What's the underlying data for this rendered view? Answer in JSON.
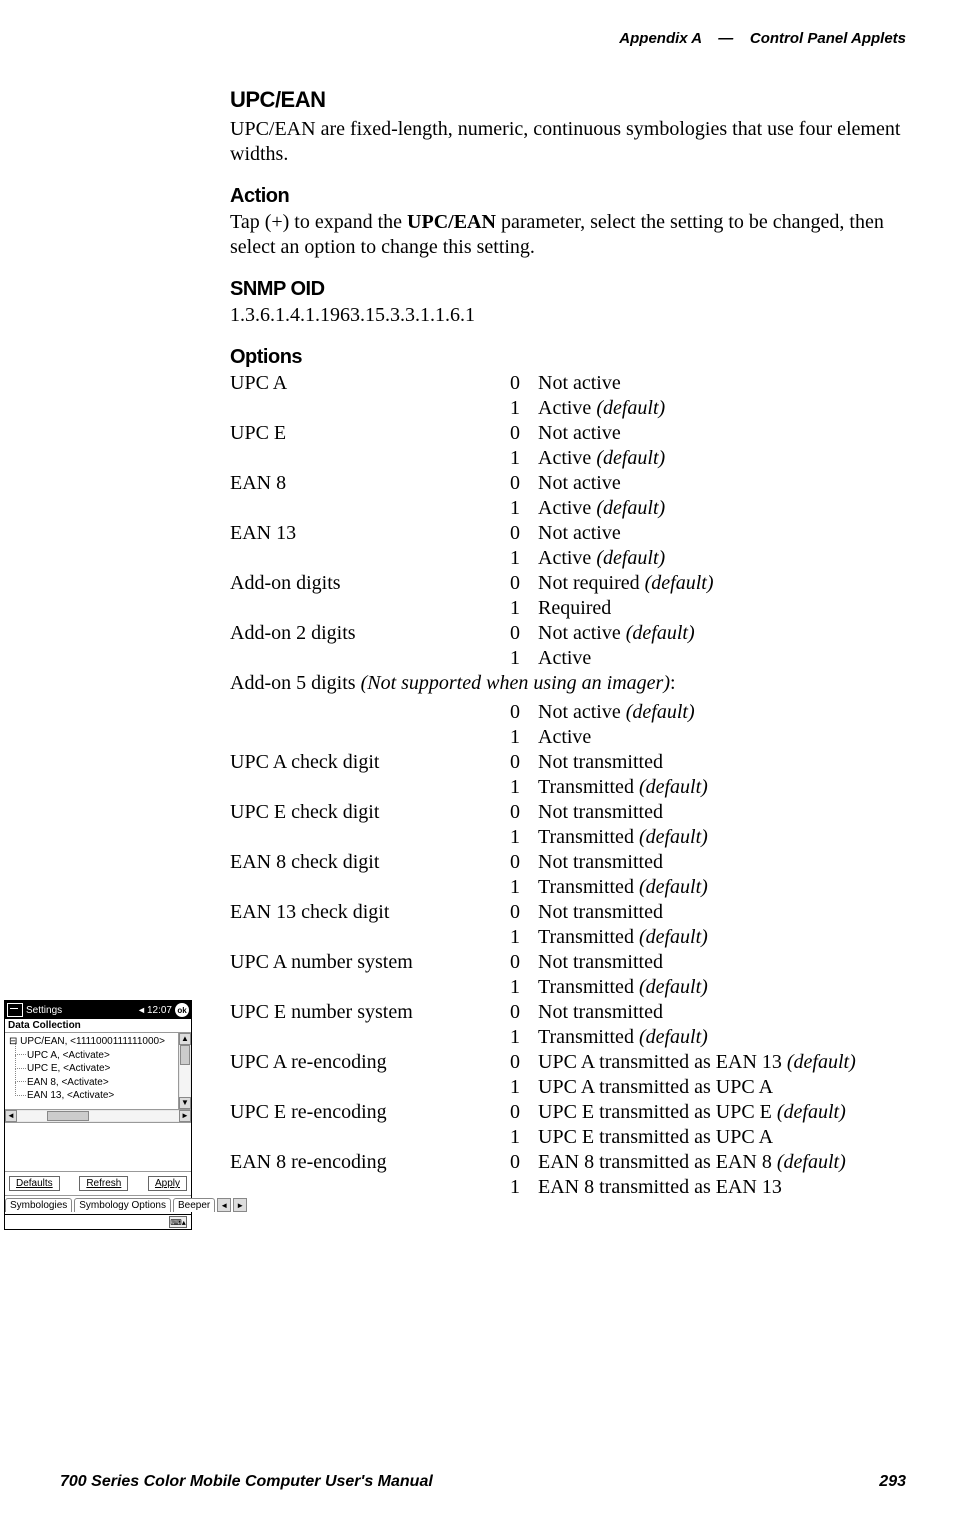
{
  "running_head": {
    "left": "Appendix A",
    "dash": "—",
    "right": "Control Panel Applets"
  },
  "upc_ean": {
    "title": "UPC/EAN",
    "body_pre": "UPC/EAN are fixed-length, numeric, continuous symbologies that use four element widths."
  },
  "action": {
    "title": "Action",
    "pre": "Tap (+) to expand the ",
    "bold": "UPC/EAN",
    "post": " parameter, select the setting to be changed, then select an option to change this setting."
  },
  "snmp": {
    "title": "SNMP OID",
    "oid": "1.3.6.1.4.1.1963.15.3.3.1.1.6.1"
  },
  "options": {
    "title": "Options"
  },
  "opt_rows": [
    {
      "label": "UPC A",
      "num": "0",
      "desc": "Not active",
      "it": ""
    },
    {
      "label": "",
      "num": "1",
      "desc": "Active ",
      "it": "(default)"
    },
    {
      "label": "UPC E",
      "num": "0",
      "desc": "Not active",
      "it": ""
    },
    {
      "label": "",
      "num": "1",
      "desc": "Active ",
      "it": "(default)"
    },
    {
      "label": "EAN 8",
      "num": "0",
      "desc": "Not active",
      "it": ""
    },
    {
      "label": "",
      "num": "1",
      "desc": "Active ",
      "it": "(default)"
    },
    {
      "label": "EAN 13",
      "num": "0",
      "desc": "Not active",
      "it": ""
    },
    {
      "label": "",
      "num": "1",
      "desc": "Active ",
      "it": "(default)"
    },
    {
      "label": "Add-on digits",
      "num": "0",
      "desc": "Not required ",
      "it": "(default)"
    },
    {
      "label": "",
      "num": "1",
      "desc": "Required",
      "it": ""
    },
    {
      "label": "Add-on 2 digits",
      "num": "0",
      "desc": "Not active ",
      "it": "(default)"
    },
    {
      "label": "",
      "num": "1",
      "desc": "Active",
      "it": ""
    }
  ],
  "addon5_line": {
    "pre": "Add-on 5 digits ",
    "it": "(Not supported when using an imager)",
    "post": ":"
  },
  "opt_rows2": [
    {
      "label": "",
      "num": "0",
      "desc": "Not active ",
      "it": "(default)"
    },
    {
      "label": "",
      "num": "1",
      "desc": "Active",
      "it": ""
    },
    {
      "label": "UPC A check digit",
      "num": "0",
      "desc": "Not transmitted",
      "it": ""
    },
    {
      "label": "",
      "num": "1",
      "desc": "Transmitted ",
      "it": "(default)"
    },
    {
      "label": "UPC E check digit",
      "num": "0",
      "desc": "Not transmitted",
      "it": ""
    },
    {
      "label": "",
      "num": "1",
      "desc": "Transmitted ",
      "it": "(default)"
    },
    {
      "label": "EAN 8 check digit",
      "num": "0",
      "desc": "Not transmitted",
      "it": ""
    },
    {
      "label": "",
      "num": "1",
      "desc": "Transmitted ",
      "it": "(default)"
    },
    {
      "label": "EAN 13 check digit",
      "num": "0",
      "desc": "Not transmitted",
      "it": ""
    },
    {
      "label": "",
      "num": "1",
      "desc": "Transmitted ",
      "it": "(default)"
    },
    {
      "label": "UPC A number system",
      "num": "0",
      "desc": "Not transmitted",
      "it": ""
    },
    {
      "label": "",
      "num": "1",
      "desc": "Transmitted ",
      "it": "(default)"
    },
    {
      "label": "UPC E number system",
      "num": "0",
      "desc": "Not transmitted",
      "it": ""
    },
    {
      "label": "",
      "num": "1",
      "desc": "Transmitted ",
      "it": "(default)"
    },
    {
      "label": "UPC A re-encoding",
      "num": "0",
      "desc": "UPC A transmitted as EAN 13 ",
      "it": "(default)"
    },
    {
      "label": "",
      "num": "1",
      "desc": "UPC A transmitted as UPC A",
      "it": ""
    },
    {
      "label": "UPC E re-encoding",
      "num": "0",
      "desc": "UPC E transmitted as UPC E ",
      "it": "(default)"
    },
    {
      "label": "",
      "num": "1",
      "desc": "UPC E transmitted as UPC A",
      "it": ""
    },
    {
      "label": "EAN 8 re-encoding",
      "num": "0",
      "desc": "EAN 8 transmitted as EAN 8 ",
      "it": "(default)"
    },
    {
      "label": "",
      "num": "1",
      "desc": "EAN 8 transmitted as EAN 13",
      "it": ""
    }
  ],
  "footer": {
    "left": "700 Series Color Mobile Computer User's Manual",
    "right": "293"
  },
  "applet": {
    "title": "Settings",
    "time": "12:07",
    "ok": "ok",
    "subtitle": "Data Collection",
    "tree_root": "UPC/EAN, <1111000111111000>",
    "tree_items": [
      "UPC A, <Activate>",
      "UPC E, <Activate>",
      "EAN 8, <Activate>",
      "EAN 13, <Activate>"
    ],
    "buttons": {
      "defaults": "Defaults",
      "refresh": "Refresh",
      "apply": "Apply"
    },
    "tabs": [
      "Symbologies",
      "Symbology Options",
      "Beeper"
    ]
  }
}
